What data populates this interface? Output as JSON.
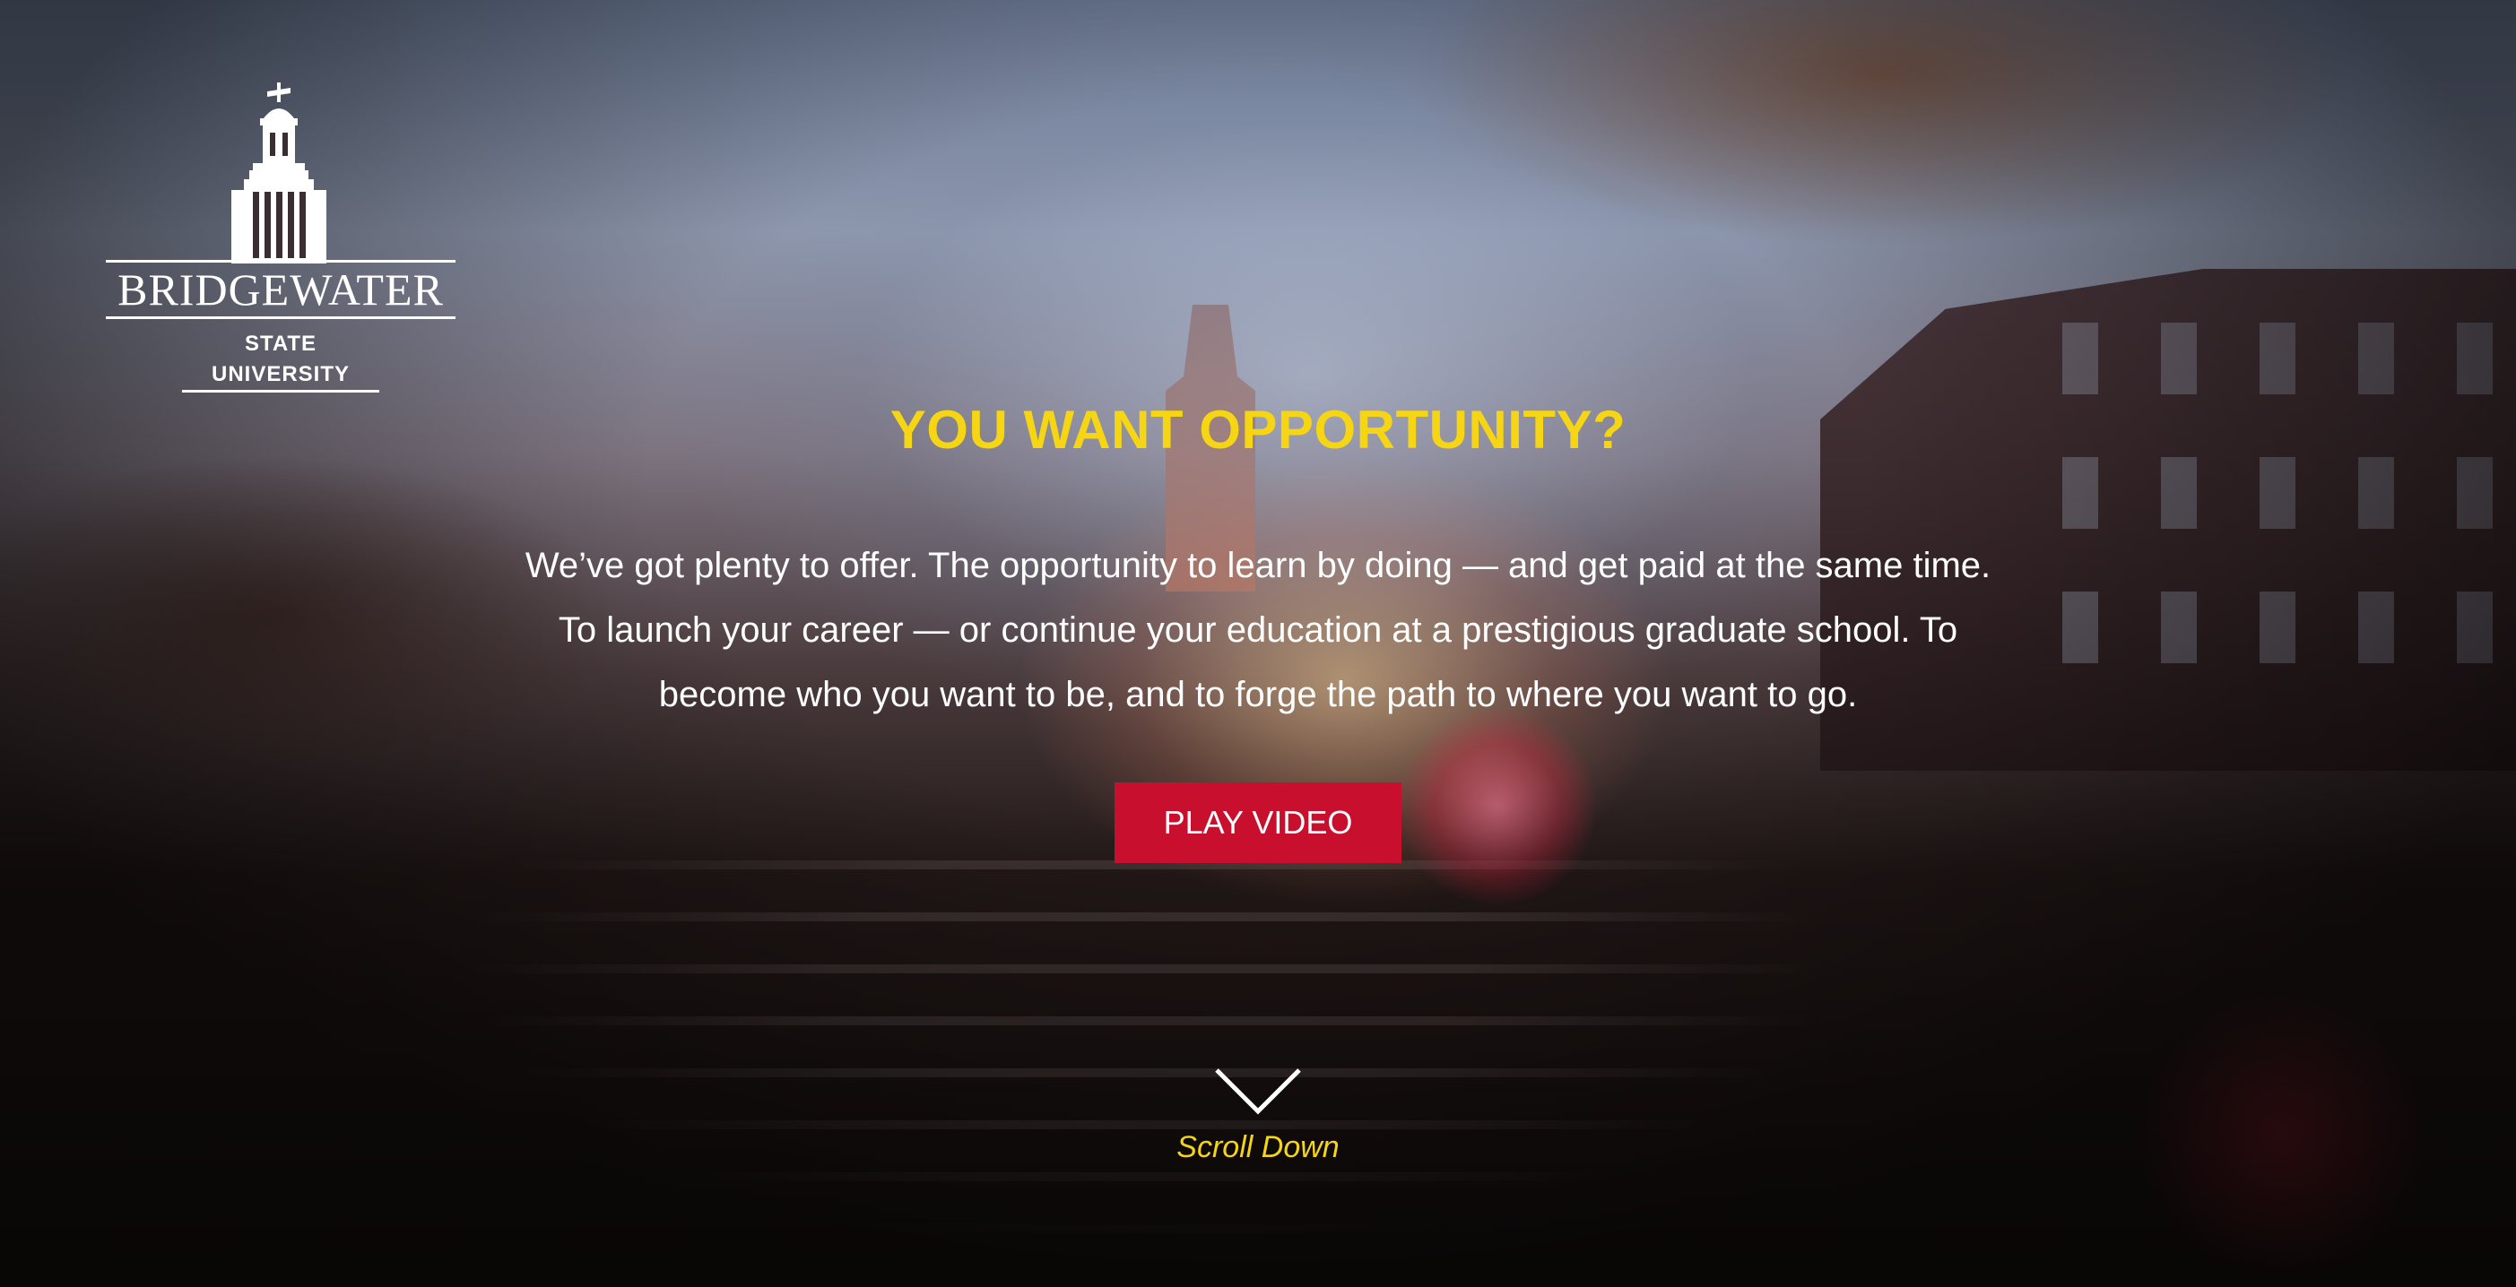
{
  "logo": {
    "icon": "clock-tower-icon",
    "name": "BRIDGEWATER",
    "subtitle": "STATE UNIVERSITY"
  },
  "hero": {
    "headline": "YOU WANT OPPORTUNITY?",
    "intro": "We’ve got plenty to offer. The opportunity to learn by doing — and get paid at the same time. To launch your career — or continue your education at a prestigious graduate school. To become who you want to be, and to forge the path to where you want to go.",
    "play_label": "PLAY VIDEO",
    "scroll_icon": "chevron-down-icon",
    "scroll_label": "Scroll Down"
  },
  "colors": {
    "accent_yellow": "#f6d514",
    "button_red": "#c8102e",
    "text_white": "#ffffff"
  }
}
